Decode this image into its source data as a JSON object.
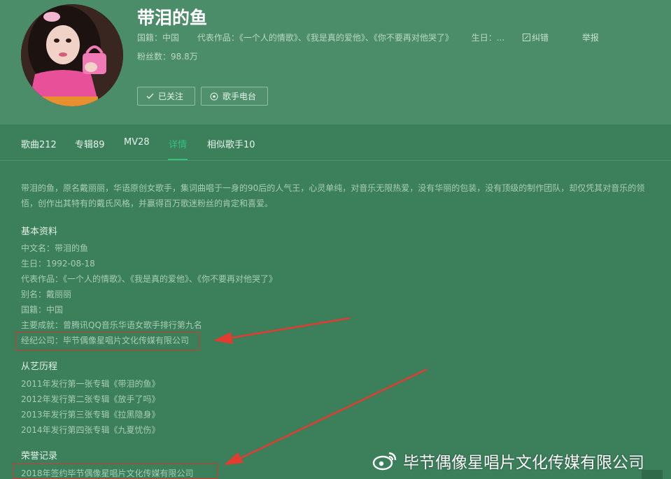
{
  "singer": {
    "name": "带泪的鱼",
    "origin": "国籍：中国",
    "works": "代表作品：《一个人的情歌》、《我是真的爱他》、《你不要再对他哭了》",
    "birthday_short": "生日：...",
    "report_error": "纠错",
    "report": "举报",
    "fans": "粉丝数：98.8万",
    "follow_btn": "已关注",
    "radio_btn": "歌手电台"
  },
  "tabs": [
    {
      "label": "歌曲212"
    },
    {
      "label": "专辑89"
    },
    {
      "label": "MV28"
    },
    {
      "label": "详情"
    },
    {
      "label": "相似歌手10"
    }
  ],
  "active_tab": "详情",
  "intro": {
    "line1": "带泪的鱼，原名戴丽丽，华语原创女歌手，集词曲唱于一身的90后的人气王，心灵单纯，对音乐无限热爱，没有华丽的包装，没有顶级的制作团队，却仅凭其对音乐的领",
    "line2": "悟，创作出其特有的戴氏风格，并赢得百万歌迷粉丝的肯定和喜爱。"
  },
  "basic": {
    "title": "基本资料",
    "items": [
      "中文名：带泪的鱼",
      "生日：1992-08-18",
      "代表作品：《一个人的情歌》、《我是真的爱他》、《你不要再对他哭了》",
      "别名：戴丽丽",
      "国籍：中国",
      "主要成就：曾腾讯QQ音乐华语女歌手排行第九名",
      "经纪公司：毕节偶像星唱片文化传媒有限公司"
    ]
  },
  "career": {
    "title": "从艺历程",
    "items": [
      "2011年发行第一张专辑《带泪的鱼》",
      "2012年发行第二张专辑《放手了吗》",
      "2013年发行第三张专辑《拉黑隐身》",
      "2014年发行第四张专辑《九夏忧伤》"
    ]
  },
  "honors": {
    "title": "荣誉记录",
    "items": [
      "2018年签约毕节偶像星唱片文化传媒有限公司"
    ]
  },
  "watermark": "毕节偶像星唱片文化传媒有限公司",
  "colors": {
    "background": "#3b7f5b",
    "header": "#4b8d69",
    "accent": "#31c27c",
    "highlight": "#d6362c"
  }
}
